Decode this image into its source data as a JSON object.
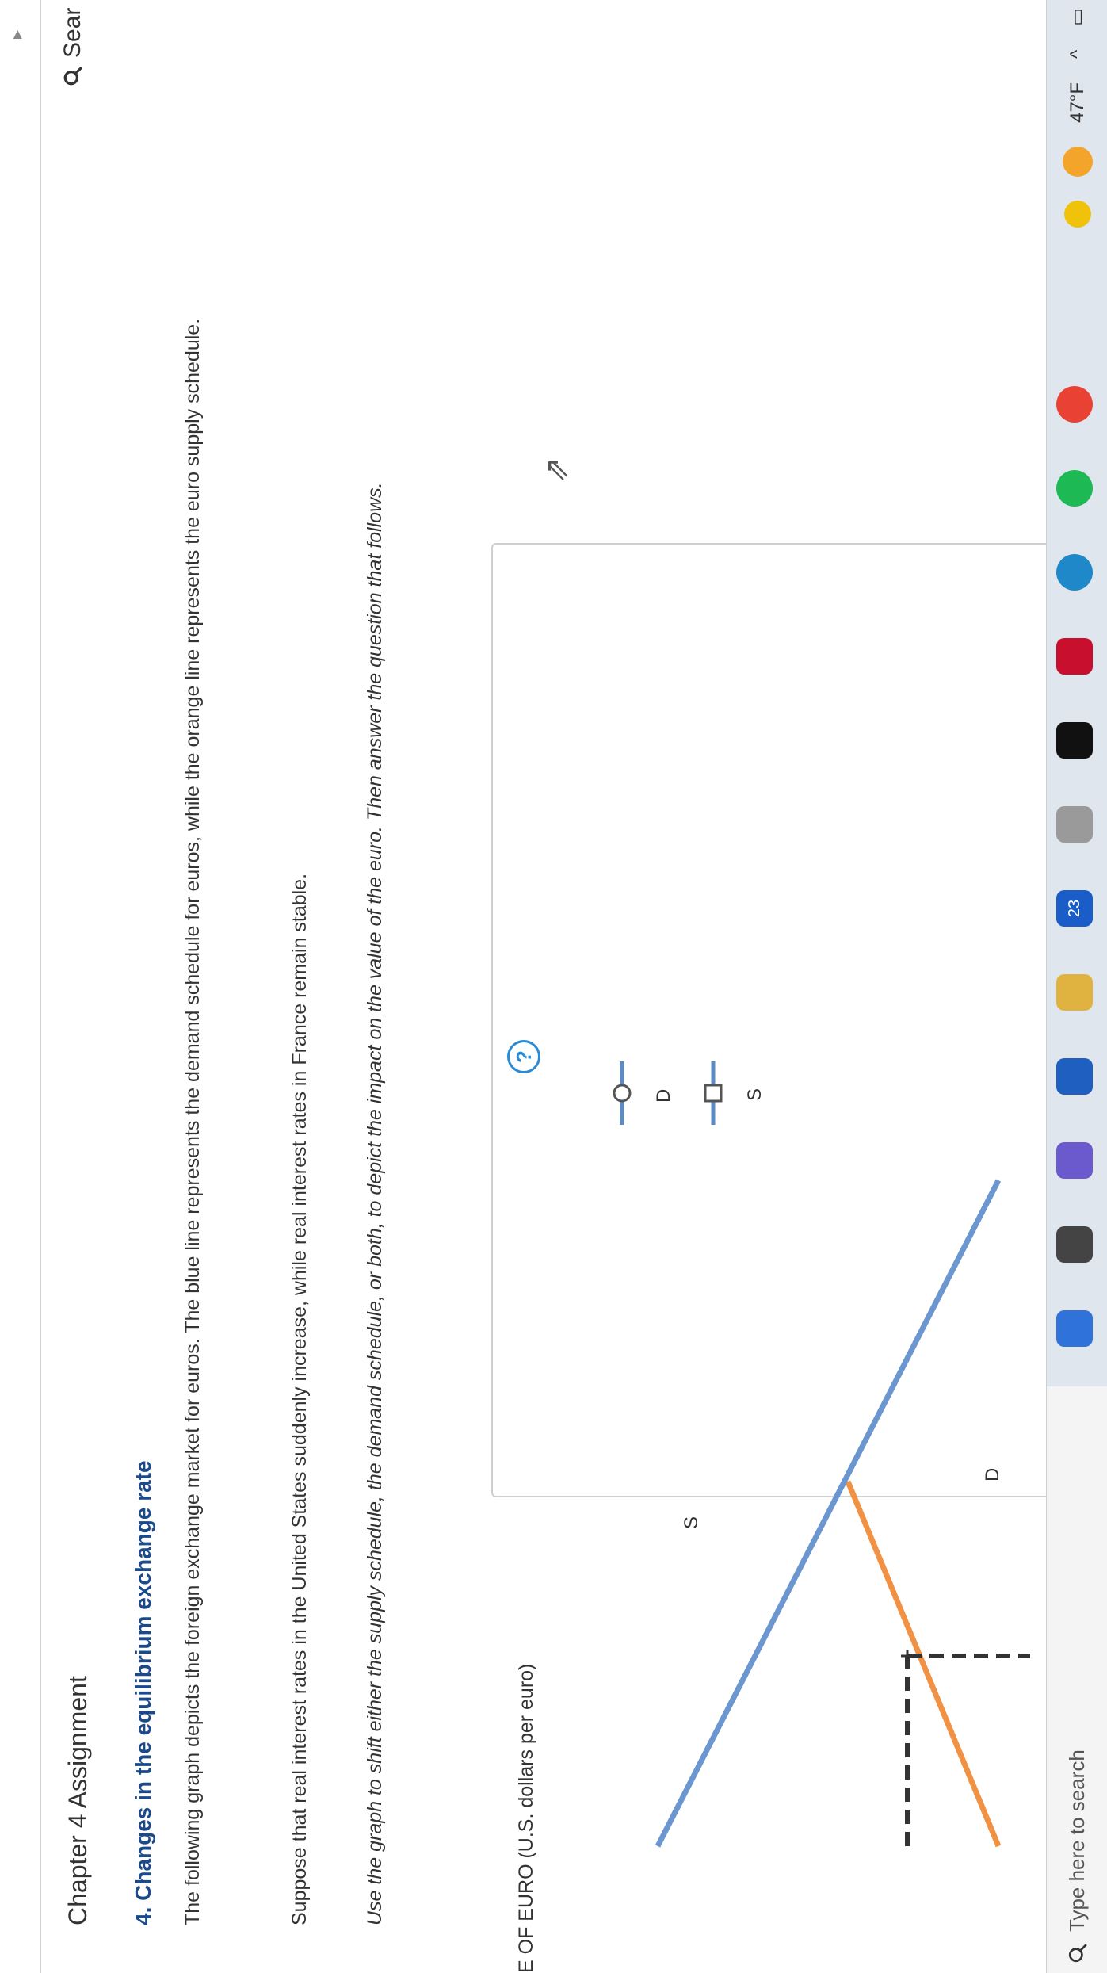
{
  "header": {
    "chapter_title": "Chapter 4 Assignment",
    "search_label": "Sear"
  },
  "question": {
    "title": "4. Changes in the equilibrium exchange rate",
    "paragraph1": "The following graph depicts the foreign exchange market for euros. The blue line represents the demand schedule for euros, while the orange line represents the euro supply schedule.",
    "paragraph2": "Suppose that real interest rates in the United States suddenly increase, while real interest rates in France remain stable.",
    "paragraph3": "Use the graph to shift either the supply schedule, the demand schedule, or both, to depict the impact on the value of the euro. Then answer the question that follows."
  },
  "graph": {
    "y_axis_label": "E OF EURO (U.S. dollars per euro)",
    "demand_label": "D",
    "supply_label": "S",
    "legend": [
      {
        "label": "D",
        "marker": "circle",
        "color": "#5b8bc5"
      },
      {
        "label": "S",
        "marker": "square",
        "color": "#e88a3a"
      }
    ],
    "help_label": "?",
    "colors": {
      "demand": "#6b96cf",
      "supply": "#f09144",
      "dashed": "#333333"
    }
  },
  "taskbar": {
    "search_placeholder": "Type here to search",
    "weather": "47°F",
    "badge": "23",
    "icons": [
      "file-explorer-icon",
      "teams-icon",
      "store-icon",
      "files-icon",
      "mail-icon",
      "winamp-icon",
      "dropbox-icon",
      "netflix-icon",
      "edge-icon",
      "spotify-icon",
      "chrome-icon"
    ]
  }
}
